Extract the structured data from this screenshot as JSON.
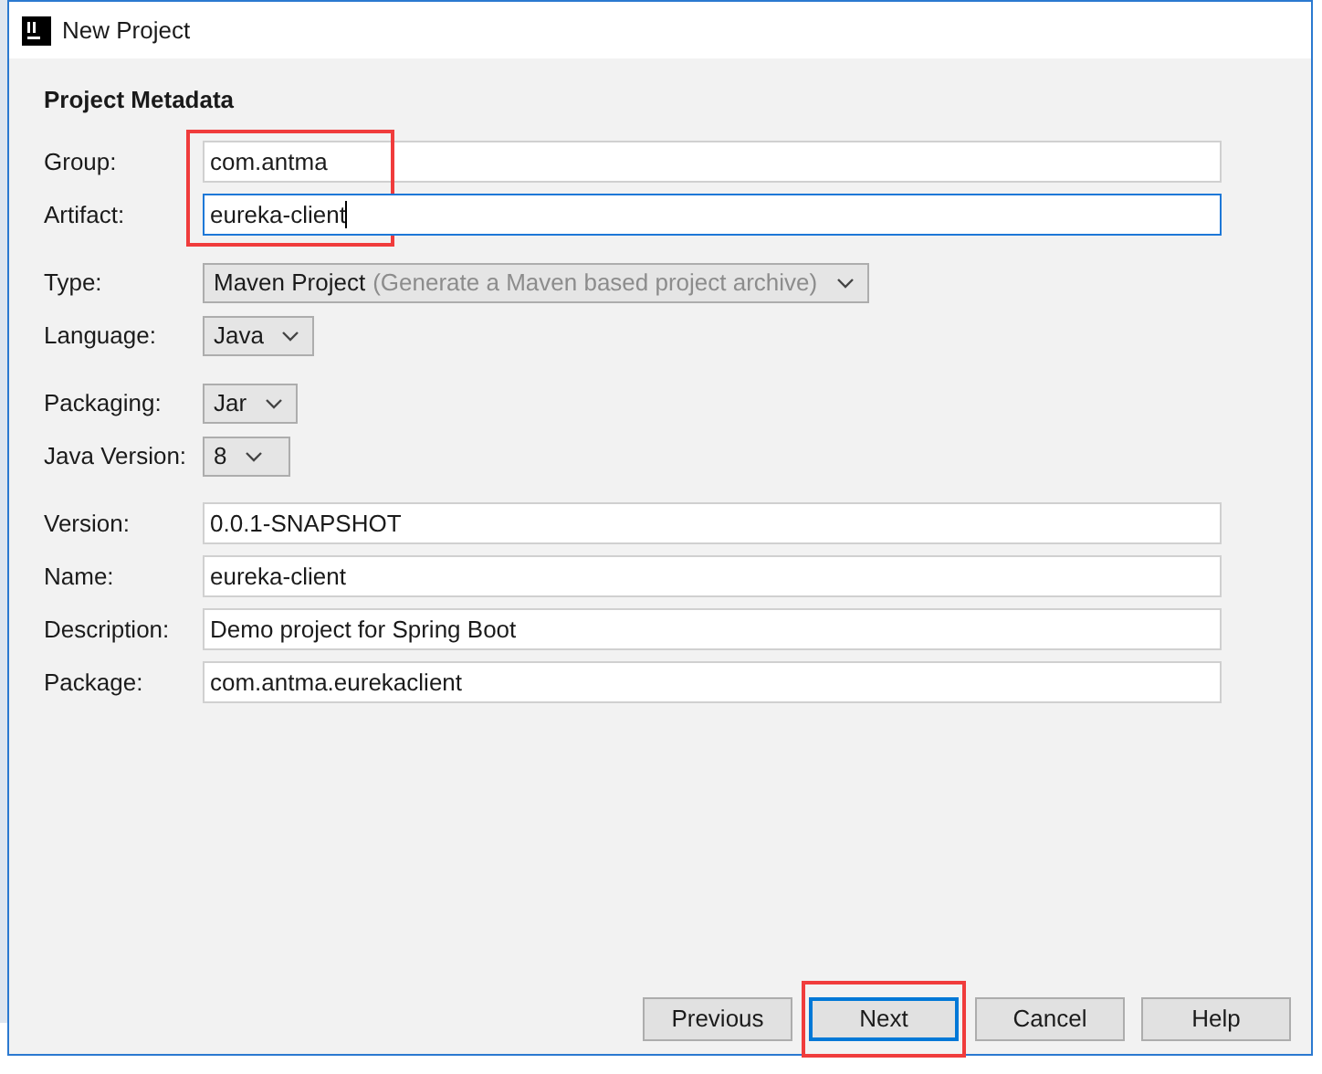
{
  "window": {
    "title": "New Project"
  },
  "section_title": "Project Metadata",
  "field_groups": [
    {
      "fields": [
        {
          "kind": "text",
          "label": "Group:",
          "value": "com.antma",
          "focused": false,
          "highlighted": true
        },
        {
          "kind": "text",
          "label": "Artifact:",
          "value": "eureka-client",
          "focused": true,
          "highlighted": true
        }
      ]
    },
    {
      "fields": [
        {
          "kind": "select",
          "label": "Type:",
          "value": "Maven Project",
          "hint": "(Generate a Maven based project archive)"
        },
        {
          "kind": "select",
          "label": "Language:",
          "value": "Java"
        }
      ]
    },
    {
      "fields": [
        {
          "kind": "select",
          "label": "Packaging:",
          "value": "Jar"
        },
        {
          "kind": "select",
          "label": "Java Version:",
          "value": "8"
        }
      ]
    },
    {
      "fields": [
        {
          "kind": "text",
          "label": "Version:",
          "value": "0.0.1-SNAPSHOT",
          "focused": false,
          "highlighted": false
        },
        {
          "kind": "text",
          "label": "Name:",
          "value": "eureka-client",
          "focused": false,
          "highlighted": false
        },
        {
          "kind": "text",
          "label": "Description:",
          "value": "Demo project for Spring Boot",
          "focused": false,
          "highlighted": false
        },
        {
          "kind": "text",
          "label": "Package:",
          "value": "com.antma.eurekaclient",
          "focused": false,
          "highlighted": false
        }
      ]
    }
  ],
  "buttons": [
    {
      "label": "Previous",
      "focused": false,
      "highlighted": false
    },
    {
      "label": "Next",
      "focused": true,
      "highlighted": true
    },
    {
      "label": "Cancel",
      "focused": false,
      "highlighted": false
    },
    {
      "label": "Help",
      "focused": false,
      "highlighted": false
    }
  ]
}
